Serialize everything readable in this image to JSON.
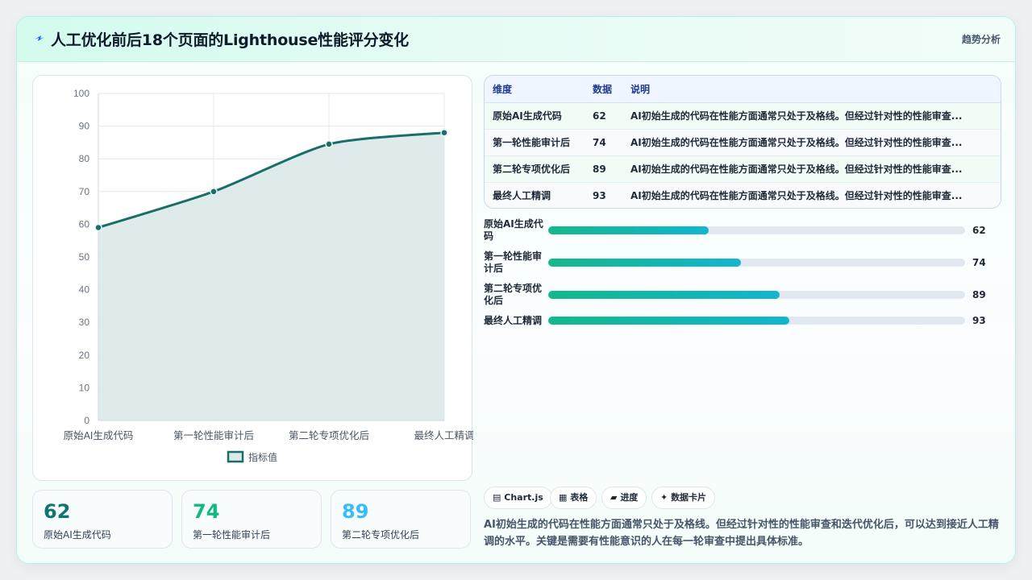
{
  "header": {
    "icon": "sparkle-icon",
    "title": "人工优化前后18个页面的Lighthouse性能评分变化",
    "tag": "趋势分析"
  },
  "colors": {
    "line": "#1a6e6a",
    "area": "#dbe9e8",
    "stat1": "#0f766e",
    "stat2": "#10b981",
    "stat3": "#38bdf8",
    "bar_start": "#14b88a",
    "bar_end": "#12b5cf"
  },
  "chart_data": {
    "type": "line",
    "categories": [
      "原始AI生成代码",
      "第一轮性能审计后",
      "第二轮专项优化后",
      "最终人工精调"
    ],
    "series": [
      {
        "name": "指标值",
        "values": [
          59,
          70,
          84.5,
          88
        ]
      }
    ],
    "ylim": [
      0,
      100
    ],
    "yticks": [
      0,
      10,
      20,
      30,
      40,
      50,
      60,
      70,
      80,
      90,
      100
    ],
    "fill": true,
    "smooth": true,
    "grid": true,
    "legend": "bottom"
  },
  "stats": [
    {
      "value": "62",
      "label": "原始AI生成代码"
    },
    {
      "value": "74",
      "label": "第一轮性能审计后"
    },
    {
      "value": "89",
      "label": "第二轮专项优化后"
    }
  ],
  "table": {
    "headers": [
      "维度",
      "数据",
      "说明"
    ],
    "rows": [
      {
        "dim": "原始AI生成代码",
        "val": "62",
        "desc": "AI初始生成的代码在性能方面通常只处于及格线。但经过针对性的性能审查..."
      },
      {
        "dim": "第一轮性能审计后",
        "val": "74",
        "desc": "AI初始生成的代码在性能方面通常只处于及格线。但经过针对性的性能审查..."
      },
      {
        "dim": "第二轮专项优化后",
        "val": "89",
        "desc": "AI初始生成的代码在性能方面通常只处于及格线。但经过针对性的性能审查..."
      },
      {
        "dim": "最终人工精调",
        "val": "93",
        "desc": "AI初始生成的代码在性能方面通常只处于及格线。但经过针对性的性能审查..."
      }
    ]
  },
  "progress": [
    {
      "label": "原始AI生成代码",
      "value": "62",
      "fraction": 0.385
    },
    {
      "label": "第一轮性能审计后",
      "value": "74",
      "fraction": 0.462
    },
    {
      "label": "第二轮专项优化后",
      "value": "89",
      "fraction": 0.555
    },
    {
      "label": "最终人工精调",
      "value": "93",
      "fraction": 0.578
    }
  ],
  "chips": [
    {
      "icon": "chart-icon",
      "glyph": "▤",
      "label": "Chart.js"
    },
    {
      "icon": "table-icon",
      "glyph": "▦",
      "label": "表格"
    },
    {
      "icon": "progress-icon",
      "glyph": "▰",
      "label": "进度"
    },
    {
      "icon": "card-icon",
      "glyph": "✦",
      "label": "数据卡片"
    }
  ],
  "summary": "AI初始生成的代码在性能方面通常只处于及格线。但经过针对性的性能审查和迭代优化后，可以达到接近人工精调的水平。关键是需要有性能意识的人在每一轮审查中提出具体标准。"
}
